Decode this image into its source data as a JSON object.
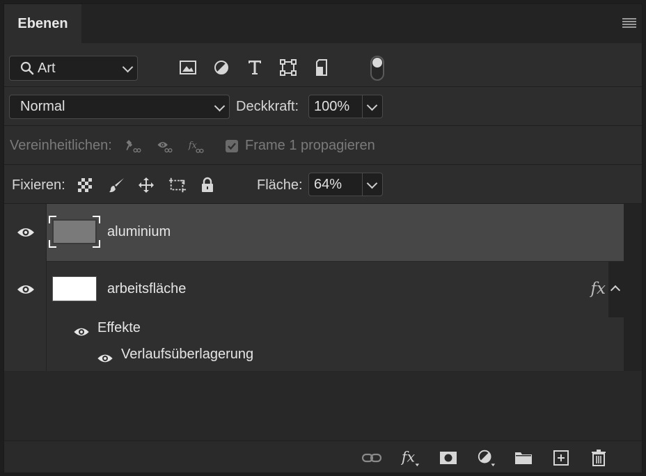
{
  "panel": {
    "tab_label": "Ebenen"
  },
  "filter": {
    "kind_label": "Art",
    "icons": [
      "image-filter-icon",
      "adjustment-filter-icon",
      "type-filter-icon",
      "shape-filter-icon",
      "smart-object-filter-icon"
    ]
  },
  "blend": {
    "mode": "Normal",
    "opacity_label": "Deckkraft:",
    "opacity_value": "100%"
  },
  "unify": {
    "label": "Vereinheitlichen:",
    "propagate_label": "Frame 1 propagieren",
    "propagate_checked": true
  },
  "lock": {
    "label": "Fixieren:",
    "fill_label": "Fläche:",
    "fill_value": "64%"
  },
  "layers": [
    {
      "name": "aluminium",
      "selected": true,
      "thumb_color": "#7a7a7a"
    },
    {
      "name": "arbeitsfläche",
      "selected": false,
      "thumb_color": "#ffffff",
      "fx": "fx",
      "effects_label": "Effekte",
      "effect_items": [
        "Verlaufsüberlagerung"
      ]
    }
  ],
  "footer": {
    "icons": [
      "link-layers-icon",
      "add-style-icon",
      "add-mask-icon",
      "adjustment-layer-icon",
      "new-group-icon",
      "new-layer-icon",
      "delete-layer-icon"
    ]
  },
  "colors": {
    "panel_bg": "#2d2d2d",
    "selected_row": "#474747",
    "field_bg": "#1f1f1f"
  }
}
